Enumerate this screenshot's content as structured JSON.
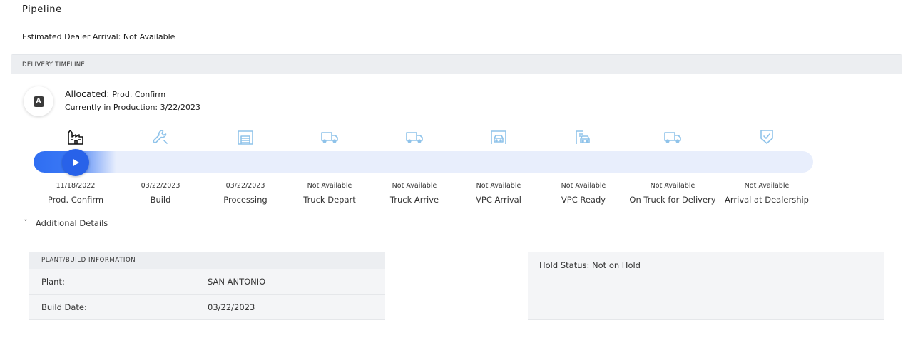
{
  "page": {
    "title": "Pipeline"
  },
  "eta": {
    "label": "Estimated Dealer Arrival:",
    "value": "Not Available"
  },
  "timeline": {
    "header": "DELIVERY TIMELINE",
    "badge_letter": "A",
    "status_label": "Allocated:",
    "status_stage": "Prod. Confirm",
    "sub_label": "Currently in Production:",
    "sub_value": "3/22/2023",
    "progress_fraction": 0.1,
    "colors": {
      "active": "#2862e9",
      "track": "#e8eefc",
      "icon_inactive": "#8fc3ea",
      "icon_active": "#111111"
    },
    "stages": [
      {
        "name": "Prod. Confirm",
        "date": "11/18/2022",
        "icon": "factory-icon",
        "active": true
      },
      {
        "name": "Build",
        "date": "03/22/2023",
        "icon": "wrench-icon",
        "active": false
      },
      {
        "name": "Processing",
        "date": "03/22/2023",
        "icon": "garage-icon",
        "active": false
      },
      {
        "name": "Truck Depart",
        "date": "Not Available",
        "icon": "truck-icon",
        "active": false
      },
      {
        "name": "Truck Arrive",
        "date": "Not Available",
        "icon": "truck-icon",
        "active": false
      },
      {
        "name": "VPC Arrival",
        "date": "Not Available",
        "icon": "car-garage-icon",
        "active": false
      },
      {
        "name": "VPC Ready",
        "date": "Not Available",
        "icon": "car-ready-icon",
        "active": false
      },
      {
        "name": "On Truck for Delivery",
        "date": "Not Available",
        "icon": "truck-icon",
        "active": false
      },
      {
        "name": "Arrival at Dealership",
        "date": "Not Available",
        "icon": "shield-check-icon",
        "active": false
      }
    ]
  },
  "details": {
    "toggle_label": "Additional Details",
    "plant": {
      "header": "PLANT/BUILD INFORMATION",
      "rows": [
        {
          "label": "Plant:",
          "value": "SAN ANTONIO"
        },
        {
          "label": "Build Date:",
          "value": "03/22/2023"
        }
      ]
    },
    "hold": {
      "label": "Hold Status:",
      "value": "Not on Hold"
    }
  }
}
